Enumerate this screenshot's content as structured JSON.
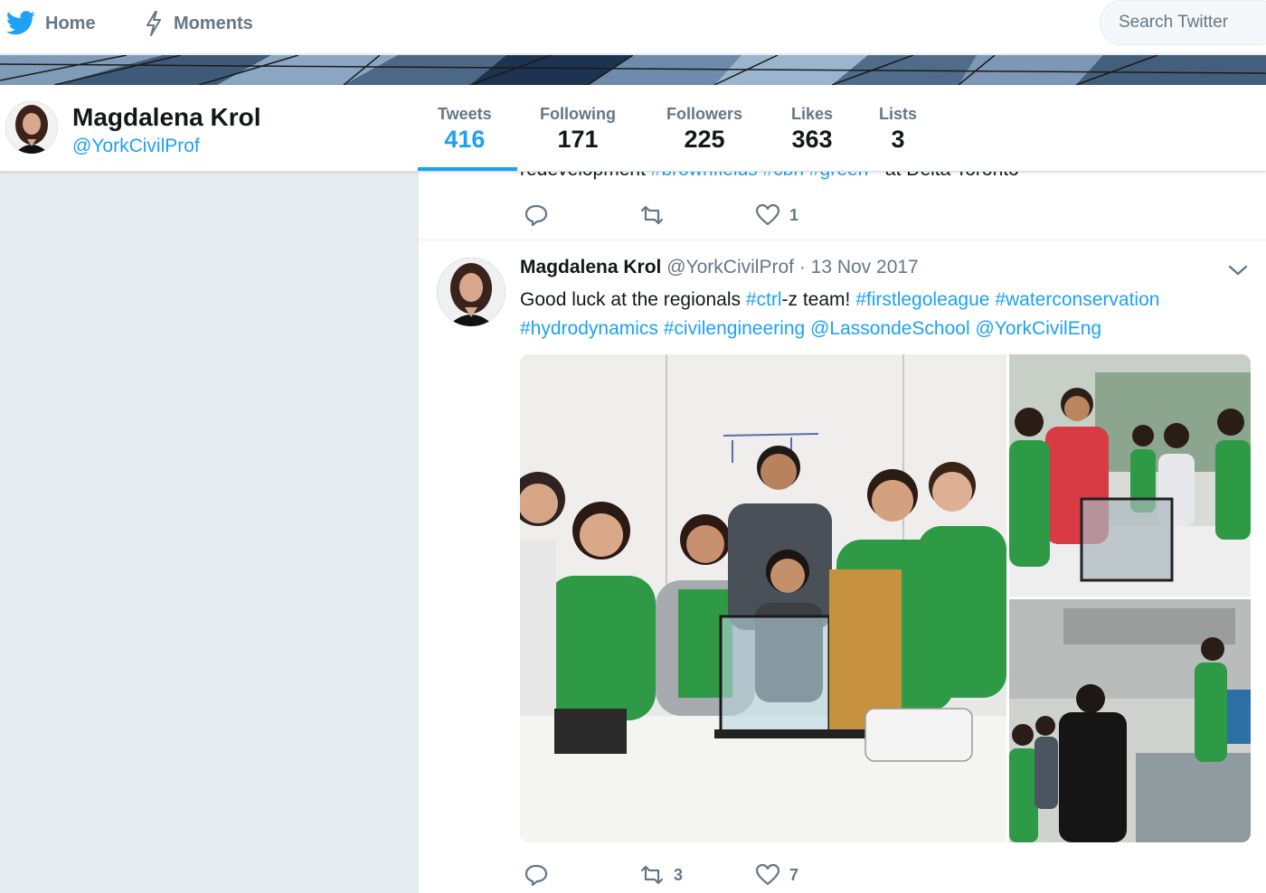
{
  "nav": {
    "home_label": "Home",
    "moments_label": "Moments",
    "search_placeholder": "Search Twitter",
    "icons": {
      "home": "twitter-bird-icon",
      "moments": "lightning-bolt-icon"
    }
  },
  "profile": {
    "name": "Magdalena Krol",
    "handle": "@YorkCivilProf",
    "stats": [
      {
        "label": "Tweets",
        "value": "416"
      },
      {
        "label": "Following",
        "value": "171"
      },
      {
        "label": "Followers",
        "value": "225"
      },
      {
        "label": "Likes",
        "value": "363"
      },
      {
        "label": "Lists",
        "value": "3"
      }
    ]
  },
  "prev_tweet": {
    "cut_text_plain": "redevelopment ",
    "cut_hashtags": "#brownfields #cbn #green",
    "cut_tail": " - at Delta Toronto",
    "likes": "1"
  },
  "tweet": {
    "name": "Magdalena Krol",
    "handle": "@YorkCivilProf",
    "date": "· 13 Nov 2017",
    "text_parts": {
      "t1": "Good luck at the regionals ",
      "h1": "#ctrl",
      "t2": "-z team! ",
      "h2": "#firstlegoleague",
      "h3": "#waterconservation",
      "h4": "#hydrodynamics",
      "h5": "#civilengineering",
      "h6": "@LassondeSchool",
      "h7": "@YorkCivilEng"
    },
    "retweets": "3",
    "likes": "7"
  },
  "colors": {
    "accent": "#1da1f2",
    "muted": "#657786",
    "background": "#e6ecf0"
  }
}
